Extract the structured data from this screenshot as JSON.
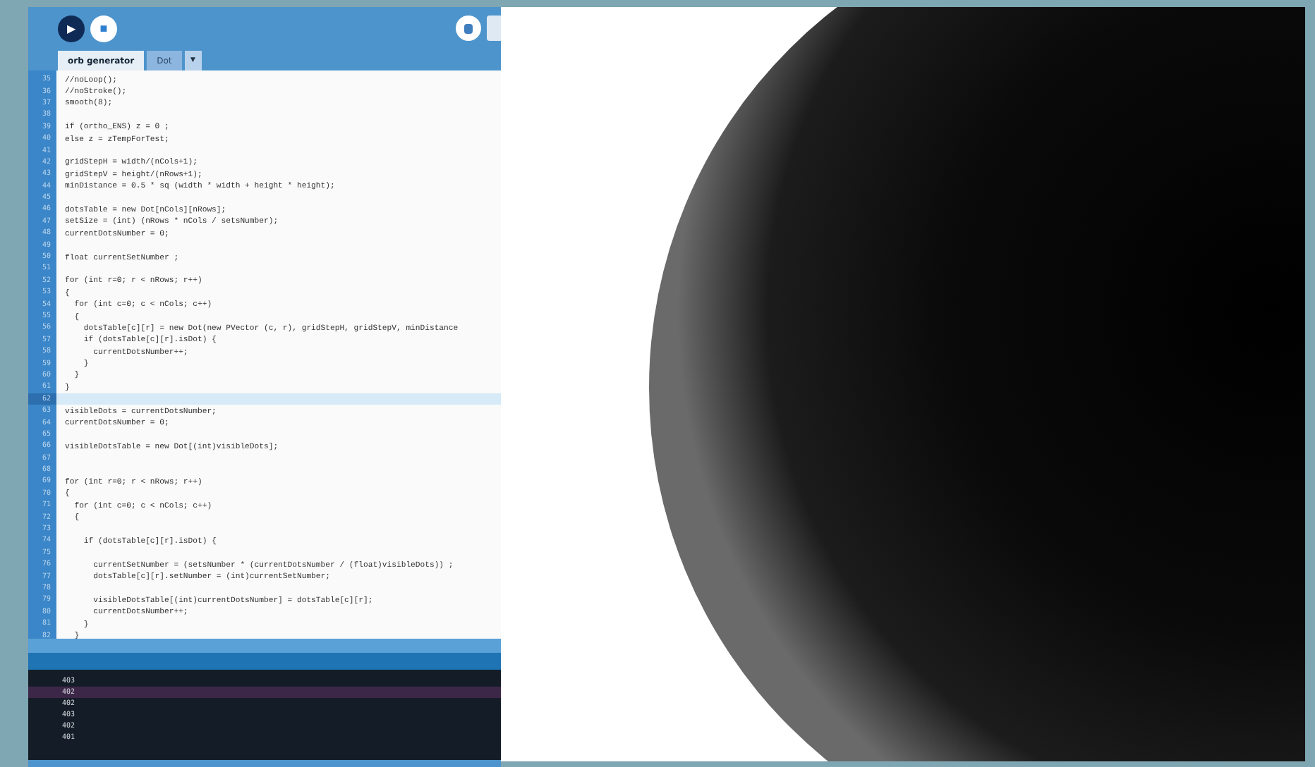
{
  "toolbar": {
    "run_button": "▶",
    "stop_button": "■"
  },
  "tabs": [
    {
      "label": "orb generator",
      "selected": true
    },
    {
      "label": "Dot",
      "selected": false
    }
  ],
  "tab_menu": "▼",
  "editor": {
    "lines": [
      {
        "number": "35",
        "code": "//noLoop();",
        "current": false
      },
      {
        "number": "36",
        "code": "//noStroke();",
        "current": false
      },
      {
        "number": "37",
        "code": "smooth(8);",
        "current": false
      },
      {
        "number": "38",
        "current": false
      },
      {
        "number": "39",
        "code": "if (ortho_ENS) z = 0 ;",
        "current": false
      },
      {
        "number": "40",
        "code": "else z = zTempForTest;",
        "current": false
      },
      {
        "number": "41",
        "current": false
      },
      {
        "number": "42",
        "code": "gridStepH = width/(nCols+1);",
        "current": false
      },
      {
        "number": "43",
        "code": "gridStepV = height/(nRows+1);",
        "current": false
      },
      {
        "number": "44",
        "code": "minDistance = 0.5 * sq (width * width + height * height);",
        "current": false
      },
      {
        "number": "45",
        "current": false
      },
      {
        "number": "46",
        "code": "dotsTable = new Dot[nCols][nRows];",
        "current": false
      },
      {
        "number": "47",
        "code": "setSize = (int) (nRows * nCols / setsNumber);",
        "current": false
      },
      {
        "number": "48",
        "code": "currentDotsNumber = 0;",
        "current": false
      },
      {
        "number": "49",
        "current": false
      },
      {
        "number": "50",
        "code": "float currentSetNumber ;",
        "current": false
      },
      {
        "number": "51",
        "current": false
      },
      {
        "number": "52",
        "code": "for (int r=0; r < nRows; r++)",
        "current": false
      },
      {
        "number": "53",
        "code": "{",
        "current": false
      },
      {
        "number": "54",
        "code": "  for (int c=0; c < nCols; c++)",
        "current": false
      },
      {
        "number": "55",
        "code": "  {",
        "current": false
      },
      {
        "number": "56",
        "code": "    dotsTable[c][r] = new Dot(new PVector (c, r), gridStepH, gridStepV, minDistance",
        "current": false
      },
      {
        "number": "57",
        "code": "    if (dotsTable[c][r].isDot) {",
        "current": false
      },
      {
        "number": "58",
        "code": "      currentDotsNumber++;",
        "current": false
      },
      {
        "number": "59",
        "code": "    }",
        "current": false
      },
      {
        "number": "60",
        "code": "  }",
        "current": false
      },
      {
        "number": "61",
        "code": "}",
        "current": false
      },
      {
        "number": "62",
        "current": true
      },
      {
        "number": "63",
        "code": "visibleDots = currentDotsNumber;",
        "current": false
      },
      {
        "number": "64",
        "code": "currentDotsNumber = 0;",
        "current": false
      },
      {
        "number": "65",
        "current": false
      },
      {
        "number": "66",
        "code": "visibleDotsTable = new Dot[(int)visibleDots];",
        "current": false
      },
      {
        "number": "67",
        "current": false
      },
      {
        "number": "68",
        "current": false
      },
      {
        "number": "69",
        "code": "for (int r=0; r < nRows; r++)",
        "current": false
      },
      {
        "number": "70",
        "code": "{",
        "current": false
      },
      {
        "number": "71",
        "code": "  for (int c=0; c < nCols; c++)",
        "current": false
      },
      {
        "number": "72",
        "code": "  {",
        "current": false
      },
      {
        "number": "73",
        "current": false
      },
      {
        "number": "74",
        "code": "    if (dotsTable[c][r].isDot) {",
        "current": false
      },
      {
        "number": "75",
        "current": false
      },
      {
        "number": "76",
        "code": "      currentSetNumber = (setsNumber * (currentDotsNumber / (float)visibleDots)) ;",
        "current": false
      },
      {
        "number": "77",
        "code": "      dotsTable[c][r].setNumber = (int)currentSetNumber;",
        "current": false
      },
      {
        "number": "78",
        "current": false
      },
      {
        "number": "79",
        "code": "      visibleDotsTable[(int)currentDotsNumber] = dotsTable[c][r];",
        "current": false
      },
      {
        "number": "80",
        "code": "      currentDotsNumber++;",
        "current": false
      },
      {
        "number": "81",
        "code": "    }",
        "current": false
      },
      {
        "number": "82",
        "code": "  }",
        "current": false
      }
    ]
  },
  "console": {
    "lines": [
      {
        "text": "403",
        "selected": false
      },
      {
        "text": "402",
        "selected": true
      },
      {
        "text": "402",
        "selected": false
      },
      {
        "text": "403",
        "selected": false
      },
      {
        "text": "402",
        "selected": false
      },
      {
        "text": "401",
        "selected": false
      }
    ]
  }
}
